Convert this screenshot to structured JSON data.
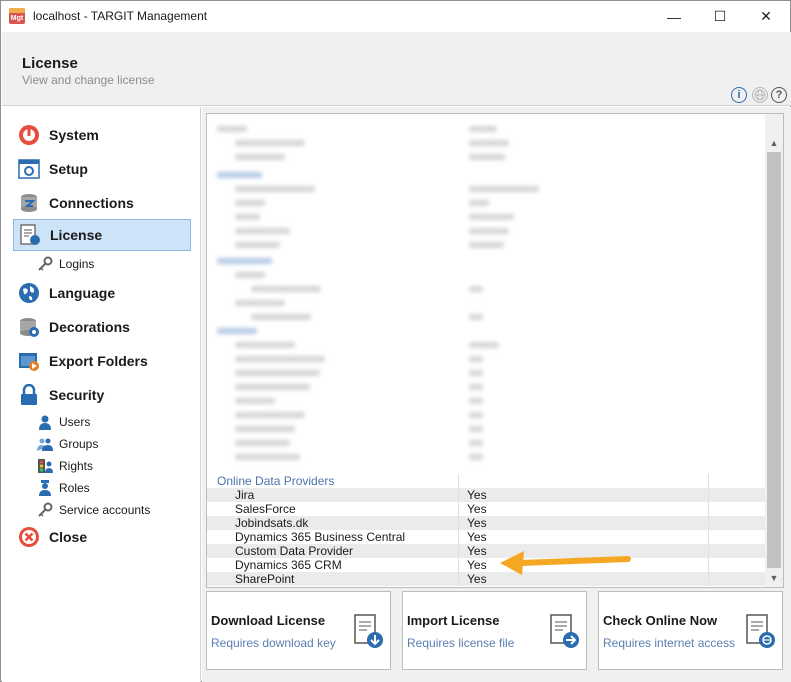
{
  "window": {
    "app_icon_text": "Mgt",
    "title": "localhost - TARGIT Management",
    "minimize_glyph": "—",
    "maximize_glyph": "☐",
    "close_glyph": "✕"
  },
  "header": {
    "title": "License",
    "subtitle": "View and change license",
    "icons": [
      "info-icon",
      "globe-icon",
      "help-icon"
    ]
  },
  "sidebar": {
    "items": [
      {
        "label": "System",
        "icon": "system-icon"
      },
      {
        "label": "Setup",
        "icon": "setup-icon"
      },
      {
        "label": "Connections",
        "icon": "connections-icon"
      },
      {
        "label": "License",
        "icon": "license-icon",
        "selected": true
      },
      {
        "label": "Logins",
        "icon": "key-icon",
        "sub": true
      },
      {
        "label": "Language",
        "icon": "language-icon"
      },
      {
        "label": "Decorations",
        "icon": "decorations-icon"
      },
      {
        "label": "Export Folders",
        "icon": "export-folders-icon"
      },
      {
        "label": "Security",
        "icon": "lock-icon"
      },
      {
        "label": "Users",
        "icon": "user-icon",
        "sub": true
      },
      {
        "label": "Groups",
        "icon": "group-icon",
        "sub": true
      },
      {
        "label": "Rights",
        "icon": "rights-icon",
        "sub": true
      },
      {
        "label": "Roles",
        "icon": "role-icon",
        "sub": true
      },
      {
        "label": "Service accounts",
        "icon": "key-icon",
        "sub": true
      },
      {
        "label": "Close",
        "icon": "close-icon"
      }
    ]
  },
  "license_grid": {
    "section_title": "Online Data Providers",
    "providers": [
      {
        "name": "Jira",
        "value": "Yes"
      },
      {
        "name": "SalesForce",
        "value": "Yes"
      },
      {
        "name": "Jobindsats.dk",
        "value": "Yes"
      },
      {
        "name": "Dynamics 365 Business Central",
        "value": "Yes"
      },
      {
        "name": "Custom Data Provider",
        "value": "Yes"
      },
      {
        "name": "Dynamics 365 CRM",
        "value": "Yes"
      },
      {
        "name": "SharePoint",
        "value": "Yes"
      }
    ]
  },
  "actions": [
    {
      "title": "Download License",
      "subtitle": "Requires download key"
    },
    {
      "title": "Import License",
      "subtitle": "Requires license file"
    },
    {
      "title": "Check Online Now",
      "subtitle": "Requires internet access"
    }
  ],
  "colors": {
    "selected_bg": "#cde3f7",
    "link_text": "#5a7fb0",
    "group_header": "#4e73a8",
    "annotation_arrow": "#f5a623"
  }
}
